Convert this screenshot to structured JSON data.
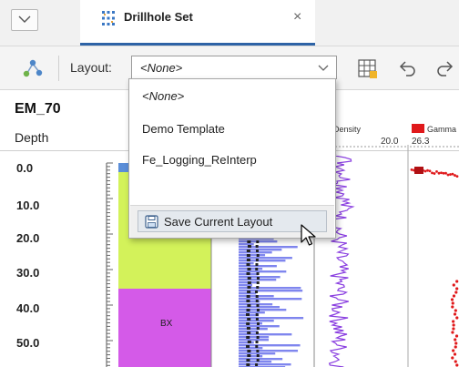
{
  "tab": {
    "title": "Drillhole Set",
    "close_glyph": "×"
  },
  "toolbar": {
    "layout_label": "Layout:",
    "layout_value": "<None>",
    "icons": [
      "drillhole-tool-icon",
      "grid-table-icon",
      "undo-icon",
      "redo-icon"
    ]
  },
  "dropdown": {
    "options": [
      "<None>",
      "Demo Template",
      "Fe_Logging_ReInterp"
    ],
    "save_button_label": "Save Current Layout"
  },
  "log": {
    "hole_name": "EM_70",
    "depth_header": "Depth",
    "depth_ticks": [
      "0.0",
      "10.0",
      "20.0",
      "30.0",
      "40.0",
      "50.0"
    ],
    "lithology_label": "BX",
    "density": {
      "name": "Density",
      "max": "20.0"
    },
    "gamma": {
      "name": "Gamma",
      "min": "26.3"
    }
  },
  "colors": {
    "tab_accent": "#2e63a6",
    "lith_blue": "#5b8ed8",
    "lith_yellow_green": "#d3f25a",
    "lith_magenta": "#d45ae8",
    "bar_fill": "#7f86ee",
    "density_line": "#8a3fe0",
    "gamma_points": "#e0191b"
  }
}
